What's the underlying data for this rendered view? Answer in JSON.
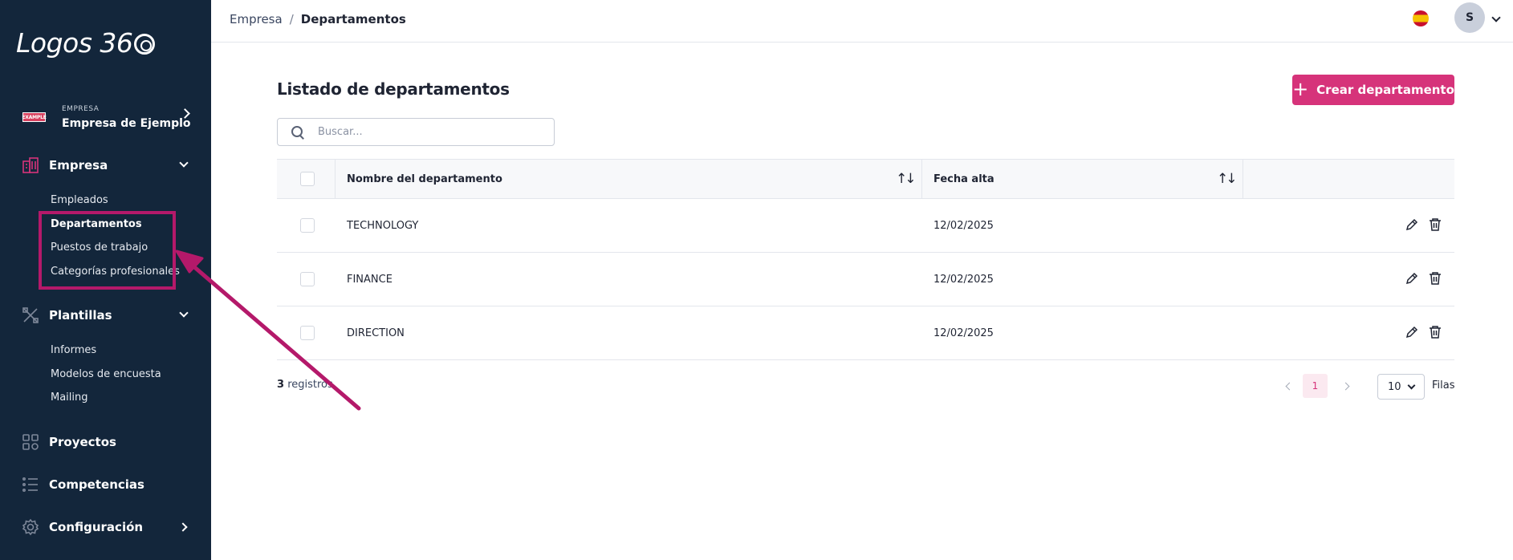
{
  "sidebar": {
    "logo_text": "Logos 36",
    "company": {
      "badge": "EXAMPLE",
      "small_label": "EMPRESA",
      "name": "Empresa de Ejemplo"
    },
    "sections": [
      {
        "label": "Empresa",
        "icon": "building-icon"
      },
      {
        "label": "Plantillas",
        "icon": "tools-icon"
      },
      {
        "label": "Proyectos",
        "icon": "grid-icon"
      },
      {
        "label": "Competencias",
        "icon": "list-icon"
      },
      {
        "label": "Configuración",
        "icon": "gear-icon"
      }
    ],
    "empresa_items": [
      "Empleados",
      "Departamentos",
      "Puestos de trabajo",
      "Categorías profesionales"
    ],
    "plantillas_items": [
      "Informes",
      "Modelos de encuesta",
      "Mailing"
    ]
  },
  "topbar": {
    "breadcrumb_parent": "Empresa",
    "breadcrumb_sep": "/",
    "breadcrumb_current": "Departamentos",
    "avatar_initial": "S"
  },
  "main": {
    "title": "Listado de departamentos",
    "create_button": "Crear departamento",
    "search_placeholder": "Buscar...",
    "columns": {
      "name": "Nombre del departamento",
      "date": "Fecha alta"
    },
    "rows": [
      {
        "name": "TECHNOLOGY",
        "date": "12/02/2025"
      },
      {
        "name": "FINANCE",
        "date": "12/02/2025"
      },
      {
        "name": "DIRECTION",
        "date": "12/02/2025"
      }
    ],
    "footer": {
      "count": "3",
      "count_label": "registros",
      "current_page": "1",
      "rows_per_page": "10",
      "rows_label": "Filas"
    }
  },
  "colors": {
    "sidebar_bg": "#13263b",
    "accent": "#d6337a",
    "annotation": "#b4196a"
  }
}
